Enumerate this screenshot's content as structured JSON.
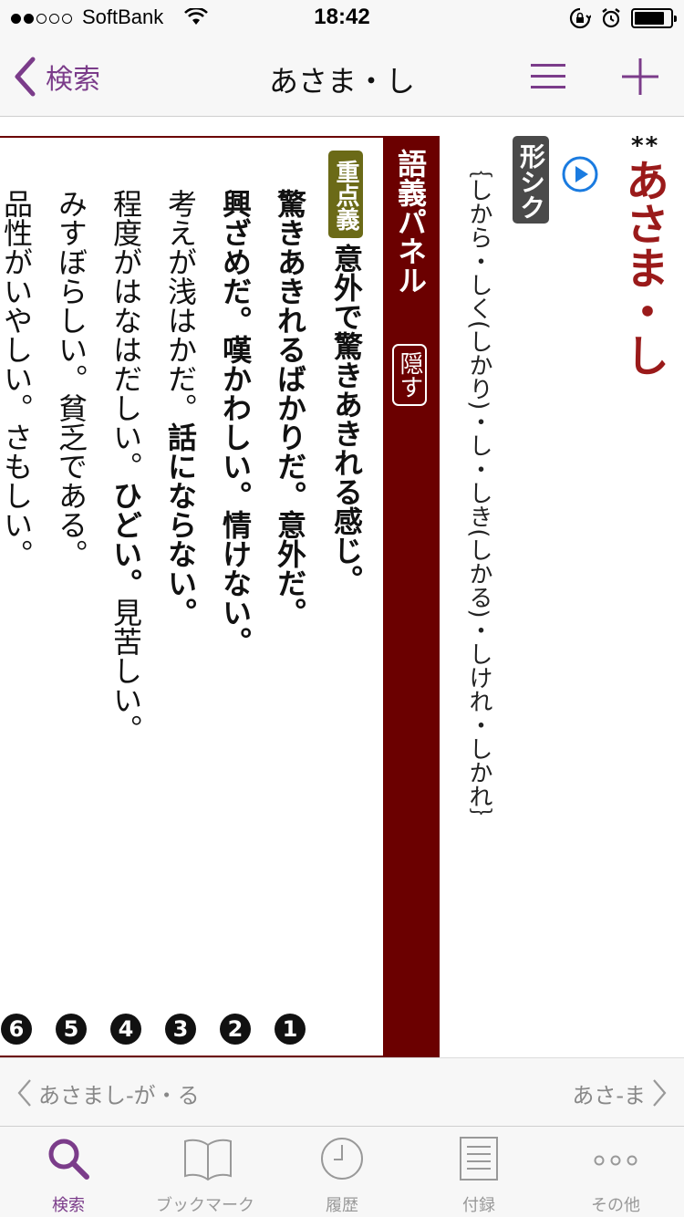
{
  "status_bar": {
    "carrier": "SoftBank",
    "time": "18:42",
    "signal_bars_filled": 2,
    "signal_bars_total": 5,
    "battery_level": 0.85
  },
  "nav": {
    "back_label": "検索",
    "title": "あさま・し",
    "menu_icon": "hamburger-menu-icon",
    "add_icon": "plus-icon"
  },
  "entry": {
    "stars": "**",
    "headword": "あさま・し",
    "pos_badge": "形シク",
    "conjugation": "｛しから・しく(しかり)・し・しき(しかる)・しけれ・しかれ｝",
    "audio_icon": "play-circle-icon"
  },
  "panel": {
    "title": "語義パネル",
    "hide_label": "隠す",
    "key_badge": "重点義",
    "key_meaning": "意外で驚きあきれる感じ。",
    "senses": [
      {
        "num": "❶",
        "parts": [
          {
            "text": "驚きあきれるばかりだ。意外だ。",
            "bold": true
          }
        ]
      },
      {
        "num": "❷",
        "parts": [
          {
            "text": "興ざめだ。嘆かわしい。情けない。",
            "bold": true
          }
        ]
      },
      {
        "num": "❸",
        "parts": [
          {
            "text": "考えが浅はかだ。",
            "bold": false
          },
          {
            "text": "話にならない。",
            "bold": true
          }
        ]
      },
      {
        "num": "❹",
        "parts": [
          {
            "text": "程度がはなはだしい。",
            "bold": false
          },
          {
            "text": "ひどい。",
            "bold": true
          },
          {
            "text": "見苦しい。",
            "bold": false
          }
        ]
      },
      {
        "num": "❺",
        "parts": [
          {
            "text": "みすぼらしい。貧乏である。",
            "bold": false
          }
        ]
      },
      {
        "num": "❻",
        "parts": [
          {
            "text": "品性がいやしい。さもしい。",
            "bold": false
          }
        ]
      }
    ]
  },
  "pager": {
    "prev_label": "あさまし‐が・る",
    "next_label": "あさ‐ま"
  },
  "tabs": [
    {
      "label": "検索",
      "icon": "search-icon",
      "active": true
    },
    {
      "label": "ブックマーク",
      "icon": "book-icon",
      "active": false
    },
    {
      "label": "履歴",
      "icon": "clock-icon",
      "active": false
    },
    {
      "label": "付録",
      "icon": "document-icon",
      "active": false
    },
    {
      "label": "その他",
      "icon": "more-icon",
      "active": false
    }
  ],
  "colors": {
    "accent_purple": "#7b3c8a",
    "headword_red": "#9a1a1a",
    "panel_maroon": "#6b0000",
    "key_badge_olive": "#6b6a17",
    "pos_badge_gray": "#4a4a4a",
    "audio_blue": "#1a7be0"
  }
}
